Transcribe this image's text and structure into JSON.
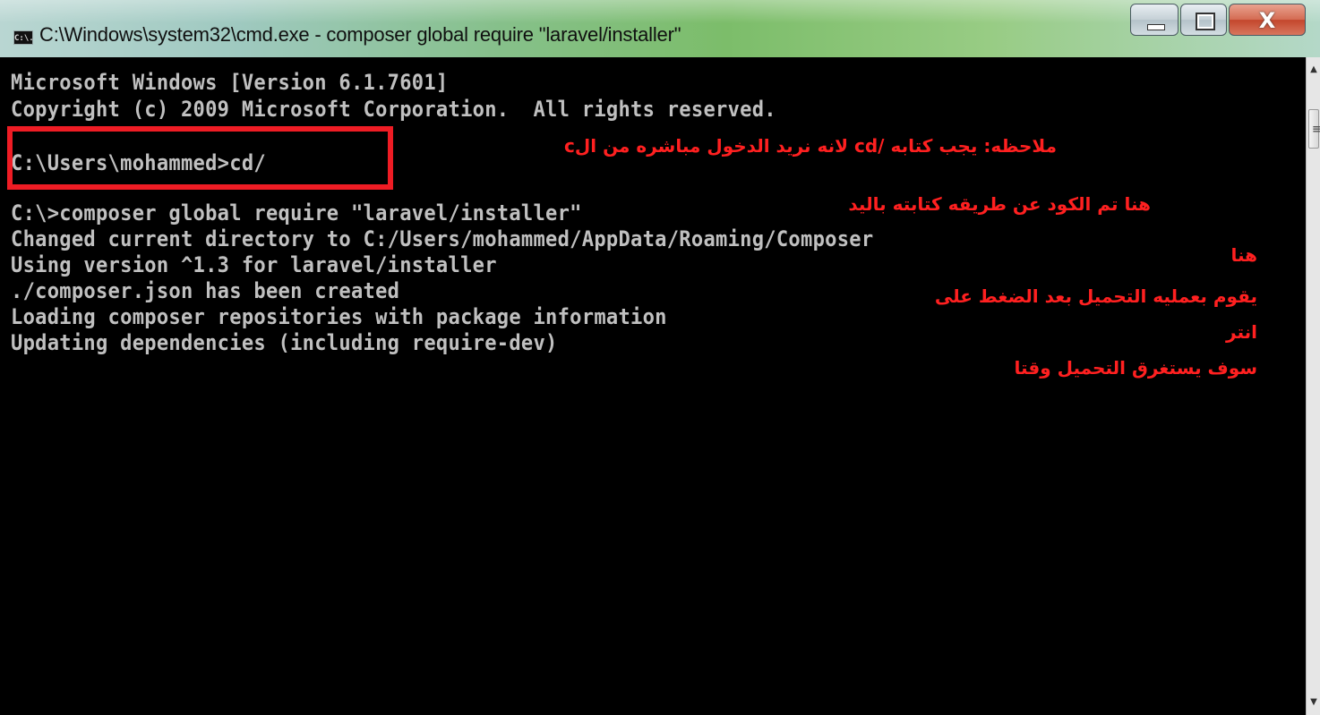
{
  "window": {
    "icon": "cmd-icon",
    "icon_text": "C:\\.",
    "title": "C:\\Windows\\system32\\cmd.exe - composer  global require \"laravel/installer\"",
    "minimize_glyph": "minimize-icon",
    "maximize_glyph": "maximize-icon",
    "close_label": "X"
  },
  "console": {
    "lines": [
      "Microsoft Windows [Version 6.1.7601]",
      "Copyright (c) 2009 Microsoft Corporation.  All rights reserved.",
      "",
      "C:\\Users\\mohammed>cd/",
      "",
      "C:\\>composer global require \"laravel/installer\"",
      "Changed current directory to C:/Users/mohammed/AppData/Roaming/Composer",
      "Using version ^1.3 for laravel/installer",
      "./composer.json has been created",
      "Loading composer repositories with package information",
      "Updating dependencies (including require-dev)"
    ]
  },
  "annotations": {
    "note1": "ملاحظه: يجب كتابه /cd لانه نريد الدخول مباشره من الc",
    "note2": "هنا تم الكود عن طريقه كتابته باليد",
    "note3_line1": "هنا",
    "note3_line2": "يقوم بعمليه التحميل بعد الضغط على",
    "note3_line3": "انتر",
    "note3_line4": "سوف يستغرق التحميل وقتا",
    "highlight_color": "#ee1c24"
  },
  "scrollbar": {
    "up_arrow": "scroll-up-arrow",
    "down_arrow": "scroll-down-arrow",
    "up_glyph": "▲",
    "down_glyph": "▼",
    "thumb_grip": "≡"
  }
}
